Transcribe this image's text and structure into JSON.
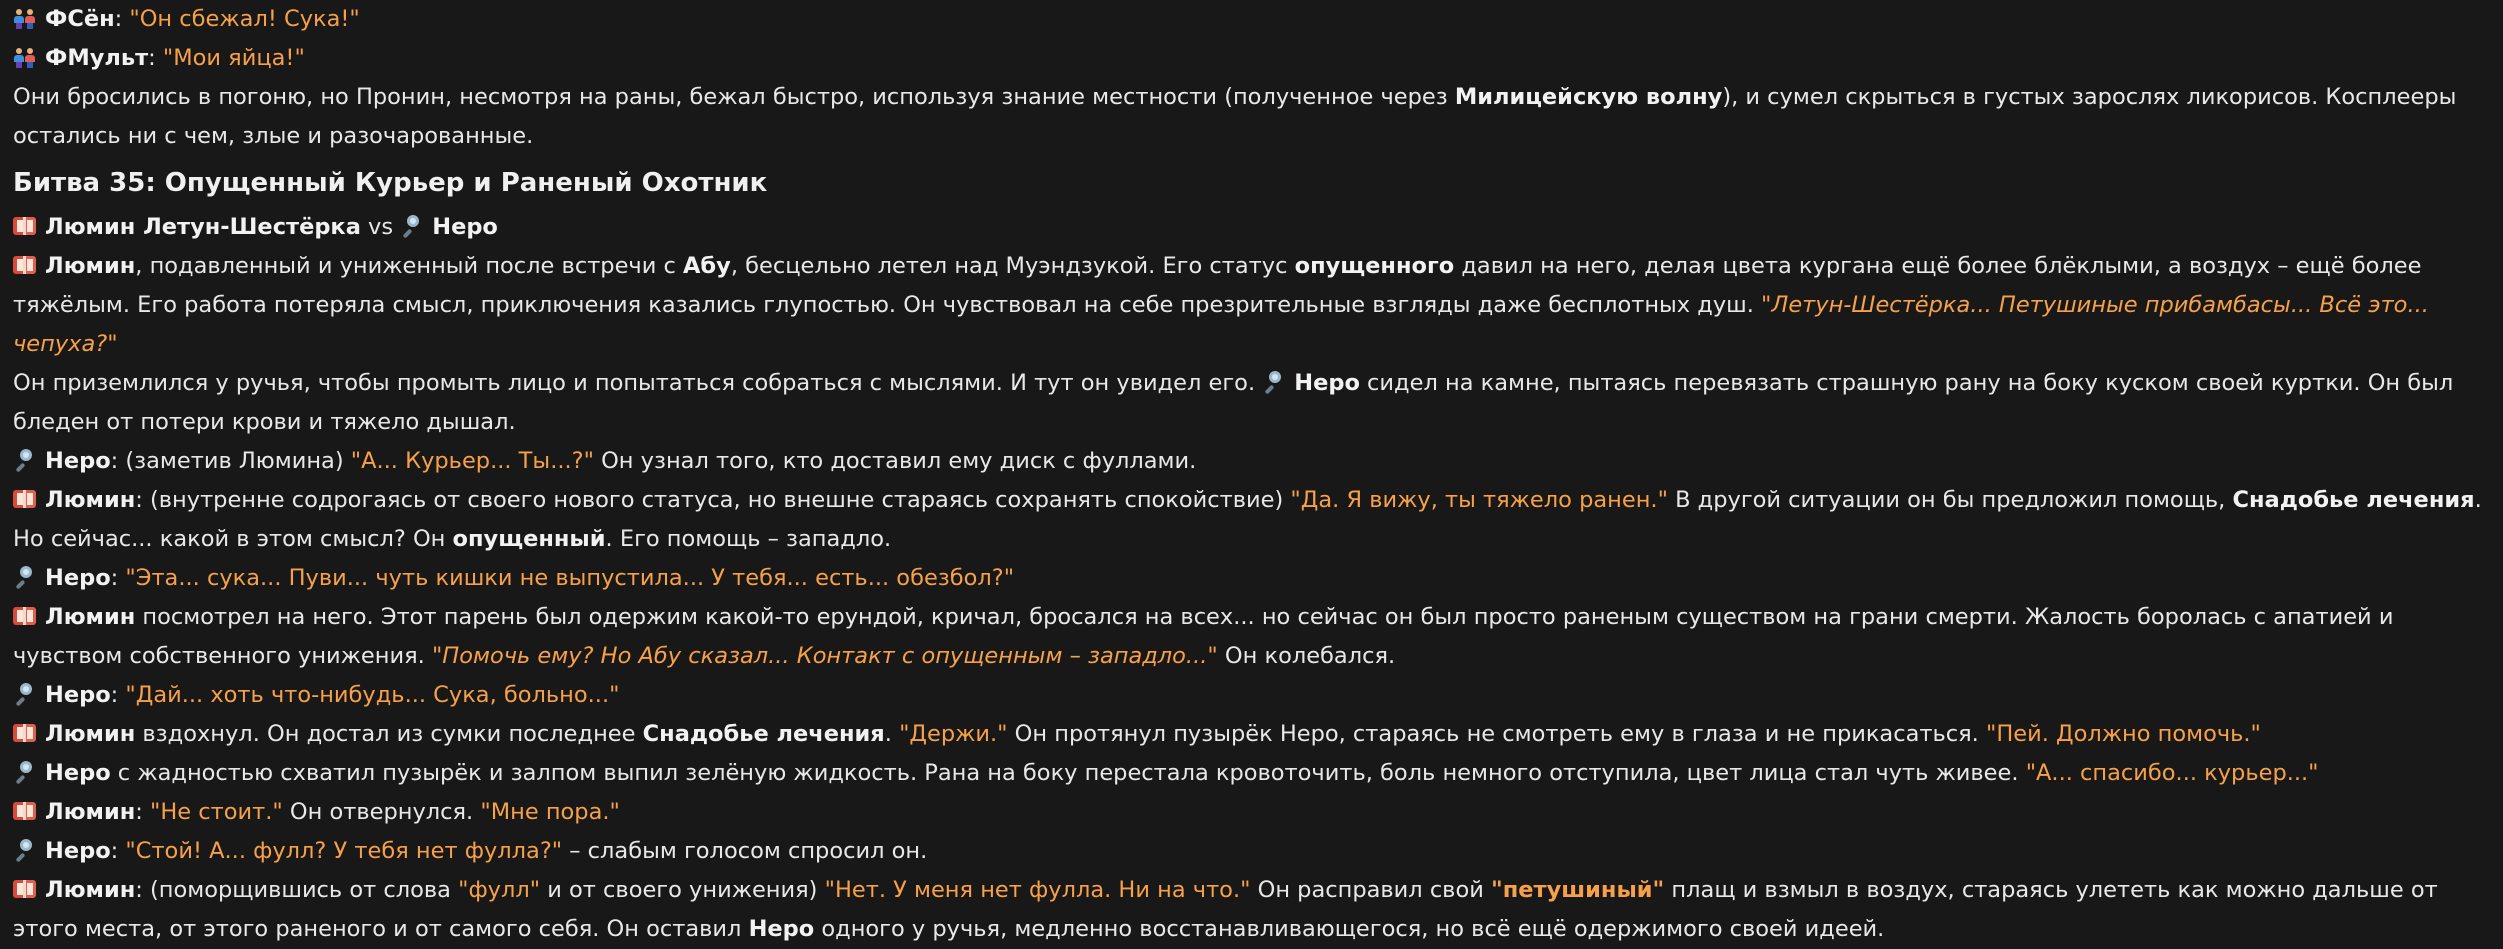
{
  "icons": {
    "people": "people-holding-hands-icon",
    "book": "open-book-icon",
    "magnifier": "magnifying-glass-icon"
  },
  "colors": {
    "background": "#181818",
    "text": "#e8e8e8",
    "quote": "#f6a14a"
  },
  "l1": {
    "speaker": "ФСён",
    "colon": ": ",
    "quote": "\"Он сбежал! Сука!\""
  },
  "l2": {
    "speaker": "ФМульт",
    "colon": ": ",
    "quote": "\"Мои яйца!\""
  },
  "p3": {
    "t1": "Они бросились в погоню, но Пронин, несмотря на раны, бежал быстро, используя знание местности (полученное через ",
    "b1": "Милицейскую волну",
    "t2": "), и сумел скрыться в густых зарослях ликорисов. Косплееры остались ни с чем, злые и разочарованные."
  },
  "heading": "Битва 35: Опущенный Курьер и Раненый Охотник",
  "vs": {
    "left": "Люмин Летун-Шестёрка",
    "mid": " vs ",
    "right": "Неро"
  },
  "p5": {
    "b1": "Люмин",
    "t1": ", подавленный и униженный после встречи с ",
    "b2": "Абу",
    "t2": ", бесцельно летел над Муэндзукой. Его статус ",
    "b3": "опущенного",
    "t3": " давил на него, делая цвета кургана ещё более блёклыми, а воздух – ещё более тяжёлым. Его работа потеряла смысл, приключения казались глупостью. Он чувствовал на себе презрительные взгляды даже бесплотных душ. ",
    "qi": "\"Летун-Шестёрка... Петушиные прибамбасы... Всё это... чепуха?\""
  },
  "p6": {
    "t1": "Он приземлился у ручья, чтобы промыть лицо и попытаться собраться с мыслями. И тут он увидел его. ",
    "b1": "Неро",
    "t2": " сидел на камне, пытаясь перевязать страшную рану на боку куском своей куртки. Он был бледен от потери крови и тяжело дышал."
  },
  "p7": {
    "b1": "Неро",
    "t1": ": (заметив Люмина) ",
    "q1": "\"А... Курьер... Ты...?\"",
    "t2": " Он узнал того, кто доставил ему диск с фуллами."
  },
  "p8": {
    "b1": "Люмин",
    "t1": ": (внутренне содрогаясь от своего нового статуса, но внешне стараясь сохранять спокойствие) ",
    "q1": "\"Да. Я вижу, ты тяжело ранен.\"",
    "t2": " В другой ситуации он бы предложил помощь, ",
    "b2": "Снадобье лечения",
    "t3": ". Но сейчас... какой в этом смысл? Он ",
    "b3": "опущенный",
    "t4": ". Его помощь – западло."
  },
  "p9": {
    "b1": "Неро",
    "t1": ": ",
    "q1": "\"Эта... сука... Пуви... чуть кишки не выпустила... У тебя... есть... обезбол?\""
  },
  "p10": {
    "b1": "Люмин",
    "t1": " посмотрел на него. Этот парень был одержим какой-то ерундой, кричал, бросался на всех... но сейчас он был просто раненым существом на грани смерти. Жалость боролась с апатией и чувством собственного унижения. ",
    "qi": "\"Помочь ему? Но Абу сказал... Контакт с опущенным – западло...\"",
    "t2": " Он колебался."
  },
  "p11": {
    "b1": "Неро",
    "t1": ": ",
    "q1": "\"Дай... хоть что-нибудь... Сука, больно...\""
  },
  "p12": {
    "b1": "Люмин",
    "t1": " вздохнул. Он достал из сумки последнее ",
    "b2": "Снадобье лечения",
    "t2": ". ",
    "q1": "\"Держи.\"",
    "t3": " Он протянул пузырёк Неро, стараясь не смотреть ему в глаза и не прикасаться. ",
    "q2": "\"Пей. Должно помочь.\""
  },
  "p13": {
    "b1": "Неро",
    "t1": " с жадностью схватил пузырёк и залпом выпил зелёную жидкость. Рана на боку перестала кровоточить, боль немного отступила, цвет лица стал чуть живее. ",
    "q1": "\"А... спасибо... курьер...\""
  },
  "p14": {
    "b1": "Люмин",
    "t1": ": ",
    "q1": "\"Не стоит.\"",
    "t2": " Он отвернулся. ",
    "q2": "\"Мне пора.\""
  },
  "p15": {
    "b1": "Неро",
    "t1": ": ",
    "q1": "\"Стой! А... фулл? У тебя нет фулла?\"",
    "t2": " – слабым голосом спросил он."
  },
  "p16": {
    "b1": "Люмин",
    "t1": ": (поморщившись от слова ",
    "q1": "\"фулл\"",
    "t2": " и от своего унижения) ",
    "q2": "\"Нет. У меня нет фулла. Ни на что.\"",
    "t3": " Он расправил свой ",
    "qb": "\"петушиный\"",
    "t4": " плащ и взмыл в воздух, стараясь улететь как можно дальше от этого места, от этого раненого и от самого себя. Он оставил ",
    "b2": "Неро",
    "t5": " одного у ручья, медленно восстанавливающегося, но всё ещё одержимого своей идеей."
  }
}
